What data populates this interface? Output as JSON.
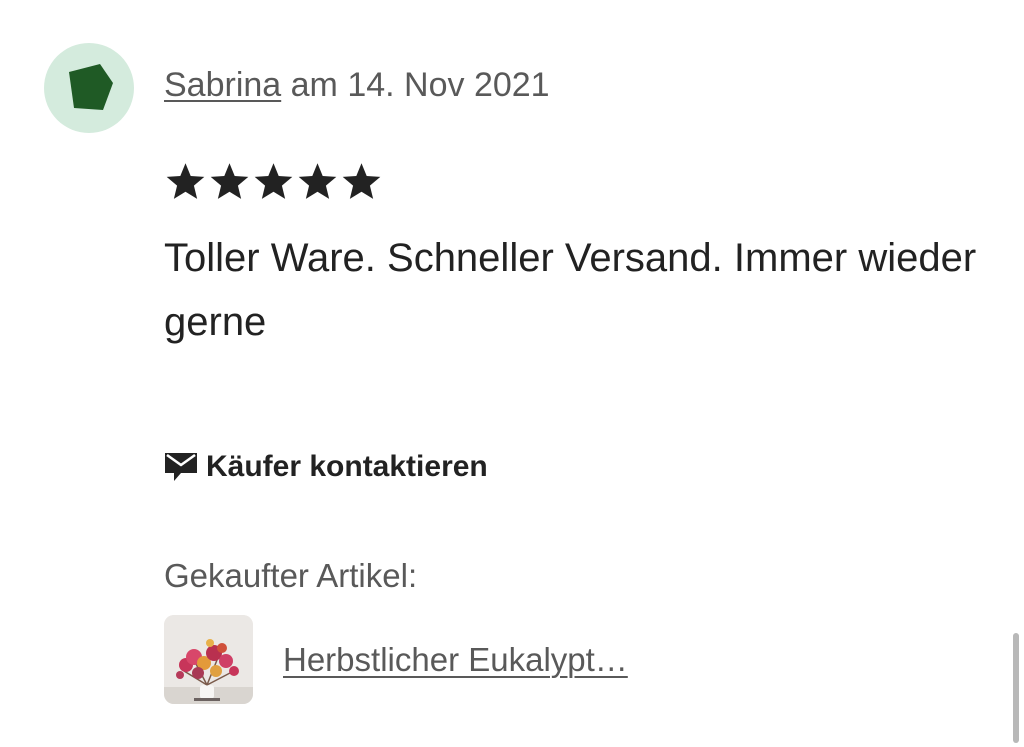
{
  "review": {
    "reviewer_name": "Sabrina",
    "date_text": " am 14. Nov 2021",
    "rating": 5,
    "rating_max": 5,
    "text": "Toller Ware. Schneller Versand. Immer wieder gerne"
  },
  "actions": {
    "contact_buyer_label": "Käufer kontaktieren",
    "contact_icon": "envelope-icon"
  },
  "purchased": {
    "label": "Gekaufter Artikel:",
    "item_title": "Herbstlicher Eukalypt…",
    "thumbnail_icon": "product-thumbnail"
  },
  "colors": {
    "avatar_bg": "#d4ebdd",
    "avatar_shape": "#1f5a25",
    "text_primary": "#222222",
    "text_secondary": "#595959"
  }
}
